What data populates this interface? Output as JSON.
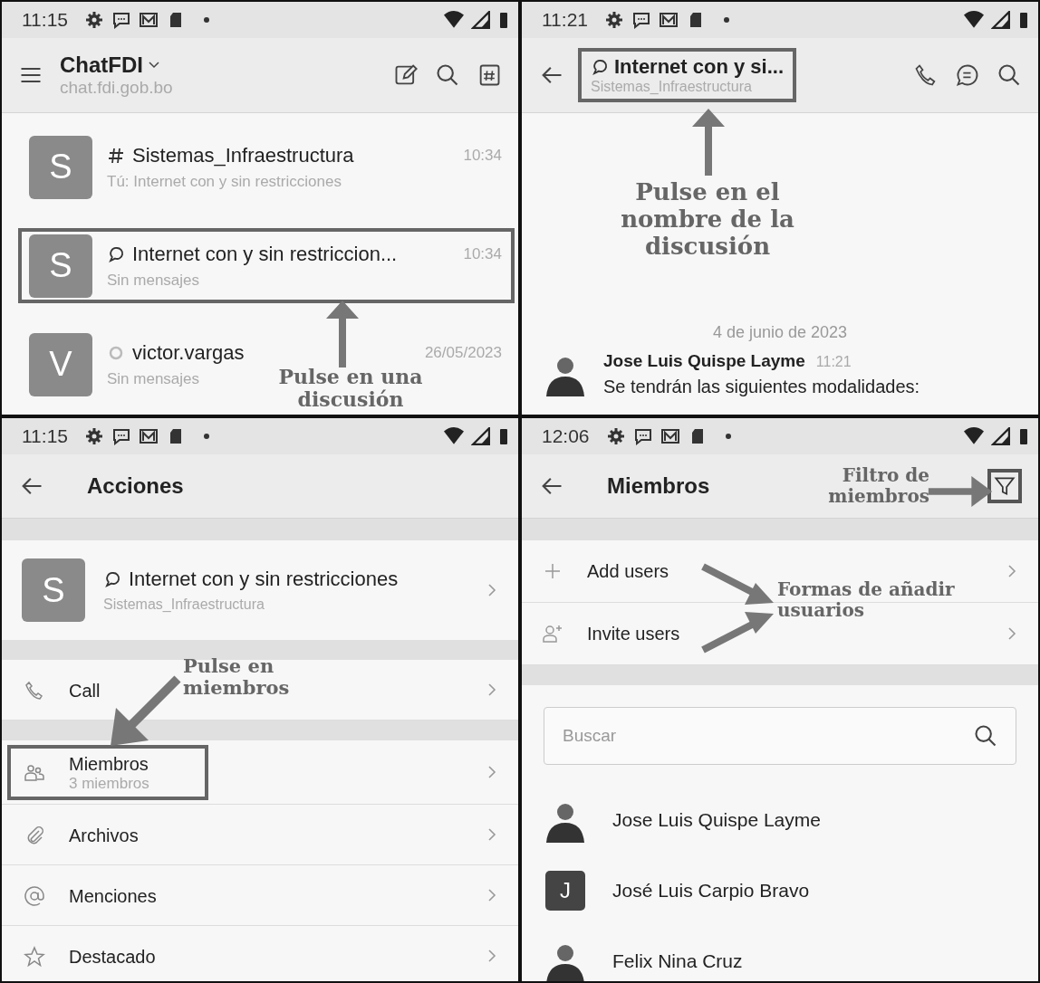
{
  "chat_list_screen": {
    "status_bar": {
      "time": "11:15"
    },
    "header": {
      "title": "ChatFDI",
      "subtitle": "chat.fdi.gob.bo"
    },
    "chats": [
      {
        "kind": "channel",
        "avatar": "S",
        "name": "Sistemas_Infraestructura",
        "time": "10:34",
        "preview": "Tú: Internet con y sin restricciones",
        "highlighted": false
      },
      {
        "kind": "discussion",
        "avatar": "S",
        "name": "Internet con y sin restriccion...",
        "time": "10:34",
        "preview": "Sin mensajes",
        "highlighted": true
      },
      {
        "kind": "direct",
        "avatar": "V",
        "name": "victor.vargas",
        "time": "26/05/2023",
        "preview": "Sin mensajes",
        "highlighted": false
      }
    ],
    "callout": "Pulse en una discusión"
  },
  "chat_room_screen": {
    "status_bar": {
      "time": "11:21"
    },
    "header": {
      "title": "Internet con y si...",
      "subtitle": "Sistemas_Infraestructura",
      "highlighted": true
    },
    "callout": "Pulse en el nombre de la discusión",
    "date_divider": "4 de junio de 2023",
    "message": {
      "author": "Jose Luis Quispe Layme",
      "time": "11:21",
      "text": "Se tendrán las siguientes modalidades:"
    }
  },
  "actions_screen": {
    "status_bar": {
      "time": "11:15"
    },
    "title": "Acciones",
    "room": {
      "avatar": "S",
      "name": "Internet con y sin restricciones",
      "subtitle": "Sistemas_Infraestructura"
    },
    "groups": [
      [
        {
          "kind": "call",
          "label": "Call",
          "highlighted": false
        }
      ],
      [
        {
          "kind": "members",
          "label": "Miembros",
          "detail": "3 miembros",
          "highlighted": true
        },
        {
          "kind": "files",
          "label": "Archivos",
          "highlighted": false
        },
        {
          "kind": "mentions",
          "label": "Menciones",
          "highlighted": false
        },
        {
          "kind": "starred",
          "label": "Destacado",
          "highlighted": false
        }
      ]
    ],
    "callout": "Pulse en miembros"
  },
  "members_screen": {
    "status_bar": {
      "time": "12:06"
    },
    "title": "Miembros",
    "filter_highlighted": true,
    "filter_callout": "Filtro de miembros",
    "actions": [
      {
        "kind": "add",
        "label": "Add users"
      },
      {
        "kind": "invite",
        "label": "Invite users"
      }
    ],
    "actions_callout": "Formas de añadir usuarios",
    "search": {
      "placeholder": "Buscar"
    },
    "members": [
      {
        "kind": "photo",
        "name": "Jose Luis Quispe Layme"
      },
      {
        "kind": "initial",
        "avatar": "J",
        "name": "José Luis Carpio Bravo"
      },
      {
        "kind": "photo",
        "name": "Felix Nina Cruz"
      }
    ]
  }
}
